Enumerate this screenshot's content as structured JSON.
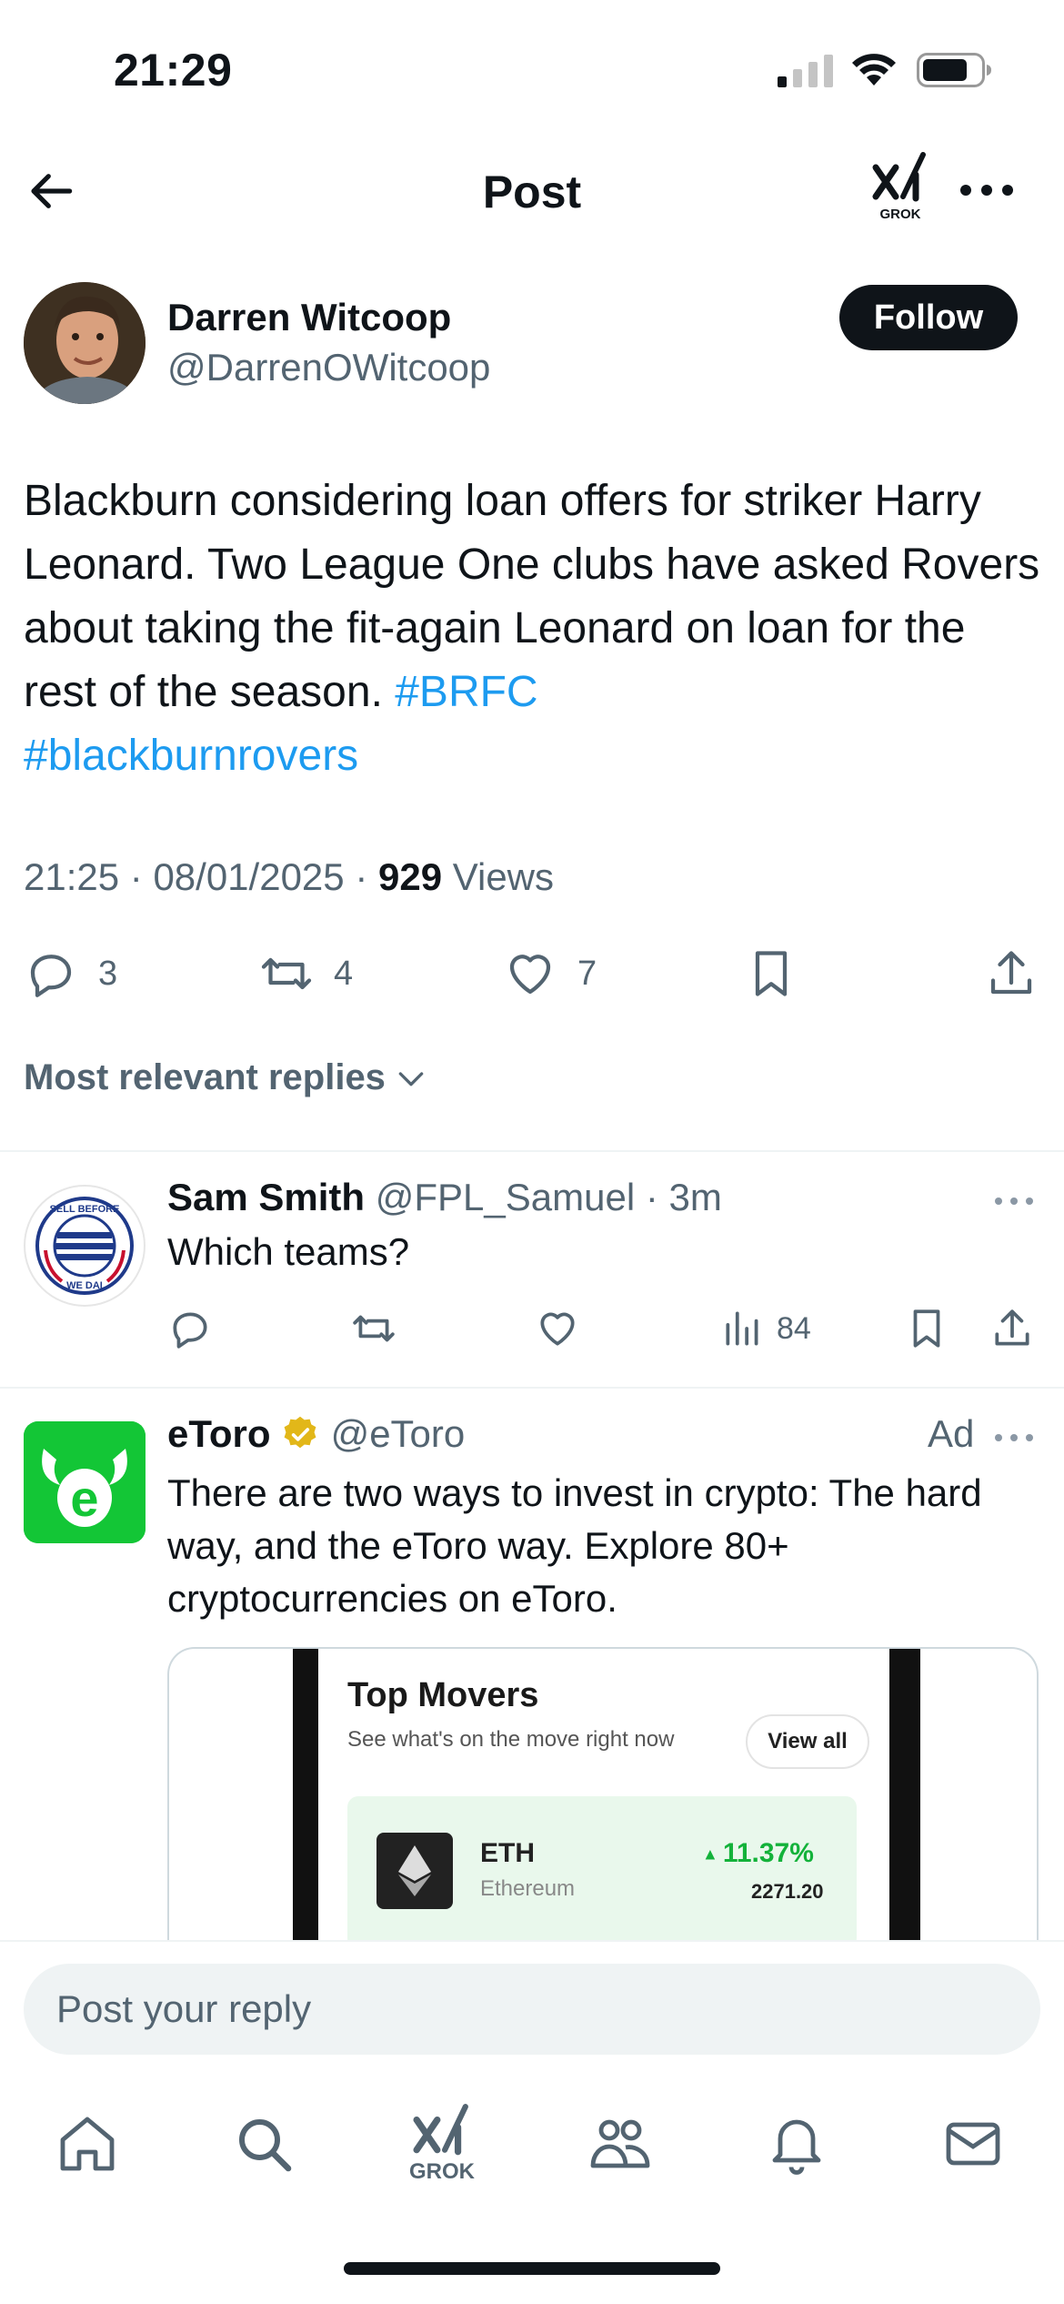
{
  "status": {
    "time": "21:29"
  },
  "nav": {
    "title": "Post",
    "grok_label": "GROK"
  },
  "post": {
    "author_name": "Darren Witcoop",
    "author_handle": "@DarrenOWitcoop",
    "follow_label": "Follow",
    "text": "Blackburn considering loan offers for striker Harry Leonard. Two League One clubs have asked Rovers about taking the fit-again Leonard on loan for the rest of the season. ",
    "hashtags": [
      "#BRFC",
      "#blackburnrovers"
    ],
    "time": "21:25",
    "date": "08/01/2025",
    "views_count": "929",
    "views_label": "Views",
    "replies": "3",
    "reposts": "4",
    "likes": "7"
  },
  "replies_filter": {
    "label": "Most relevant replies"
  },
  "reply": {
    "name": "Sam Smith",
    "handle": "@FPL_Samuel",
    "age": "3m",
    "text": "Which teams?",
    "views": "84",
    "avatar_text_top": "SELL BEFORE",
    "avatar_text_bottom": "WE DAI"
  },
  "ad": {
    "name": "eToro",
    "handle": "@eToro",
    "label": "Ad",
    "text": "There are two ways to invest in crypto: The hard way, and the eToro way. Explore 80+ cryptocurrencies on eToro.",
    "card": {
      "title": "Top Movers",
      "subtitle": "See what's on the move right now",
      "view_all": "View all",
      "coin_symbol": "ETH",
      "coin_name": "Ethereum",
      "coin_change": "11.37%",
      "coin_price": "2271.20"
    }
  },
  "reply_input": {
    "placeholder": "Post your reply"
  },
  "tabbar": {
    "grok_label": "GROK"
  },
  "colors": {
    "accent": "#1d9bf0",
    "text": "#0f1419",
    "muted": "#536471",
    "etoro_green": "#13c636"
  }
}
